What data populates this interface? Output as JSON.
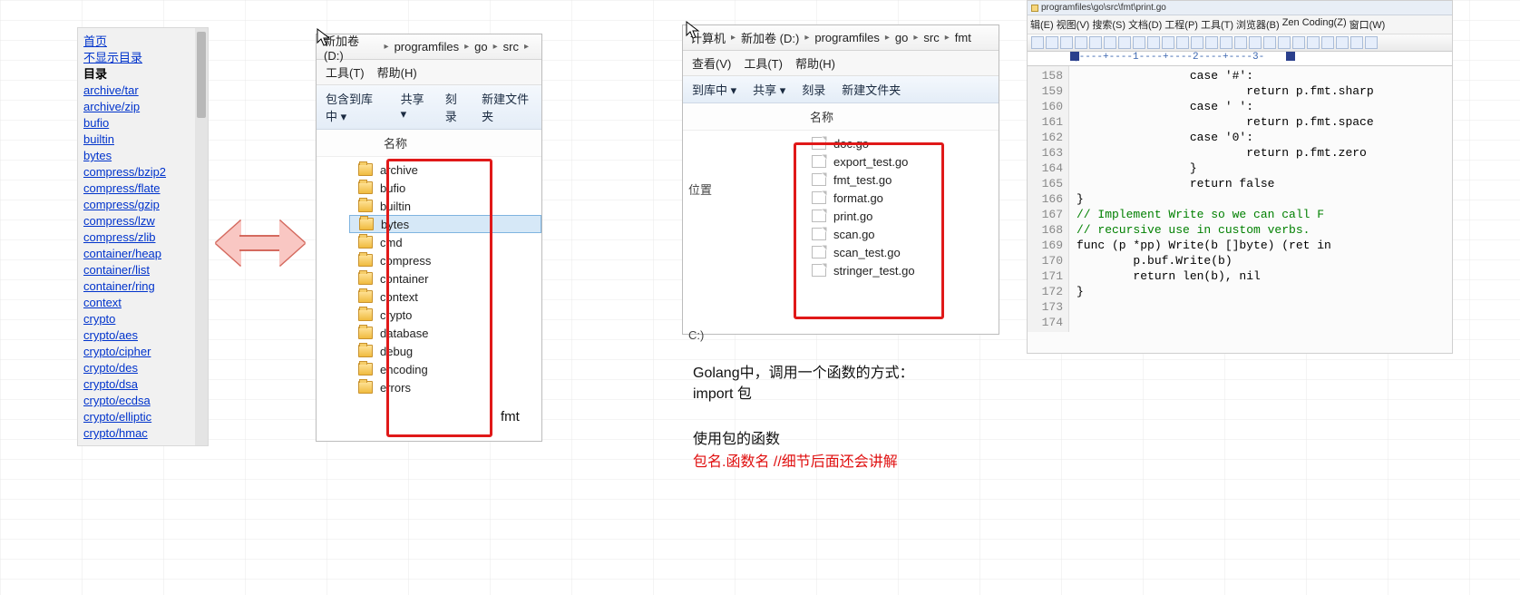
{
  "sidebar": {
    "top_home": "首页",
    "top_nodir": "不显示目录",
    "top_dir": "目录",
    "packages": [
      "archive/tar",
      "archive/zip",
      "bufio",
      "builtin",
      "bytes",
      "compress/bzip2",
      "compress/flate",
      "compress/gzip",
      "compress/lzw",
      "compress/zlib",
      "container/heap",
      "container/list",
      "container/ring",
      "context",
      "crypto",
      "crypto/aes",
      "crypto/cipher",
      "crypto/des",
      "crypto/dsa",
      "crypto/ecdsa",
      "crypto/elliptic",
      "crypto/hmac"
    ]
  },
  "explorer1": {
    "crumbs": [
      "新加卷 (D:)",
      "programfiles",
      "go",
      "src"
    ],
    "menu": {
      "tools": "工具(T)",
      "help": "帮助(H)"
    },
    "toolbar": {
      "addlib": "包含到库中 ▾",
      "share": "共享 ▾",
      "burn": "刻录",
      "newfolder": "新建文件夹"
    },
    "column": "名称",
    "folders": [
      "archive",
      "bufio",
      "builtin",
      "bytes",
      "cmd",
      "compress",
      "container",
      "context",
      "crypto",
      "database",
      "debug",
      "encoding",
      "errors"
    ],
    "selected": "bytes"
  },
  "explorer2": {
    "crumbs": [
      "计算机",
      "新加卷 (D:)",
      "programfiles",
      "go",
      "src",
      "fmt"
    ],
    "menu": {
      "view": "查看(V)",
      "tools": "工具(T)",
      "help": "帮助(H)"
    },
    "toolbar": {
      "addlib": "到库中 ▾",
      "share": "共享 ▾",
      "burn": "刻录",
      "newfolder": "新建文件夹"
    },
    "column": "名称",
    "side": {
      "pos": "位置",
      "drive": "C:)"
    },
    "files": [
      "doc.go",
      "export_test.go",
      "fmt_test.go",
      "format.go",
      "print.go",
      "scan.go",
      "scan_test.go",
      "stringer_test.go"
    ]
  },
  "fmt_label": "fmt",
  "editor": {
    "path": "programfiles\\go\\src\\fmt\\print.go",
    "menus": [
      "辑(E)",
      "视图(V)",
      "搜索(S)",
      "文档(D)",
      "工程(P)",
      "工具(T)",
      "浏览器(B)",
      "Zen Coding(Z)",
      "窗口(W)"
    ],
    "ruler": "|----+----1----+----2----+----3-",
    "lines": [
      {
        "n": 158,
        "t": "                case '#':"
      },
      {
        "n": 159,
        "t": "                        return p.fmt.sharp"
      },
      {
        "n": 160,
        "t": "                case ' ':"
      },
      {
        "n": 161,
        "t": "                        return p.fmt.space"
      },
      {
        "n": 162,
        "t": "                case '0':"
      },
      {
        "n": 163,
        "t": "                        return p.fmt.zero"
      },
      {
        "n": 164,
        "t": "                }"
      },
      {
        "n": 165,
        "t": "                return false"
      },
      {
        "n": 166,
        "t": "}"
      },
      {
        "n": 167,
        "t": ""
      },
      {
        "n": 168,
        "t": "// Implement Write so we can call F",
        "cm": true
      },
      {
        "n": 169,
        "t": "// recursive use in custom verbs.",
        "cm": true
      },
      {
        "n": 170,
        "t": "func (p *pp) Write(b []byte) (ret in"
      },
      {
        "n": 171,
        "t": "        p.buf.Write(b)"
      },
      {
        "n": 172,
        "t": "        return len(b), nil"
      },
      {
        "n": 173,
        "t": "}"
      },
      {
        "n": 174,
        "t": ""
      }
    ]
  },
  "notes": {
    "line1": "Golang中，调用一个函数的方式：",
    "line2": "import  包",
    "line3": "使用包的函数",
    "line4": "包名.函数名  //细节后面还会讲解"
  }
}
